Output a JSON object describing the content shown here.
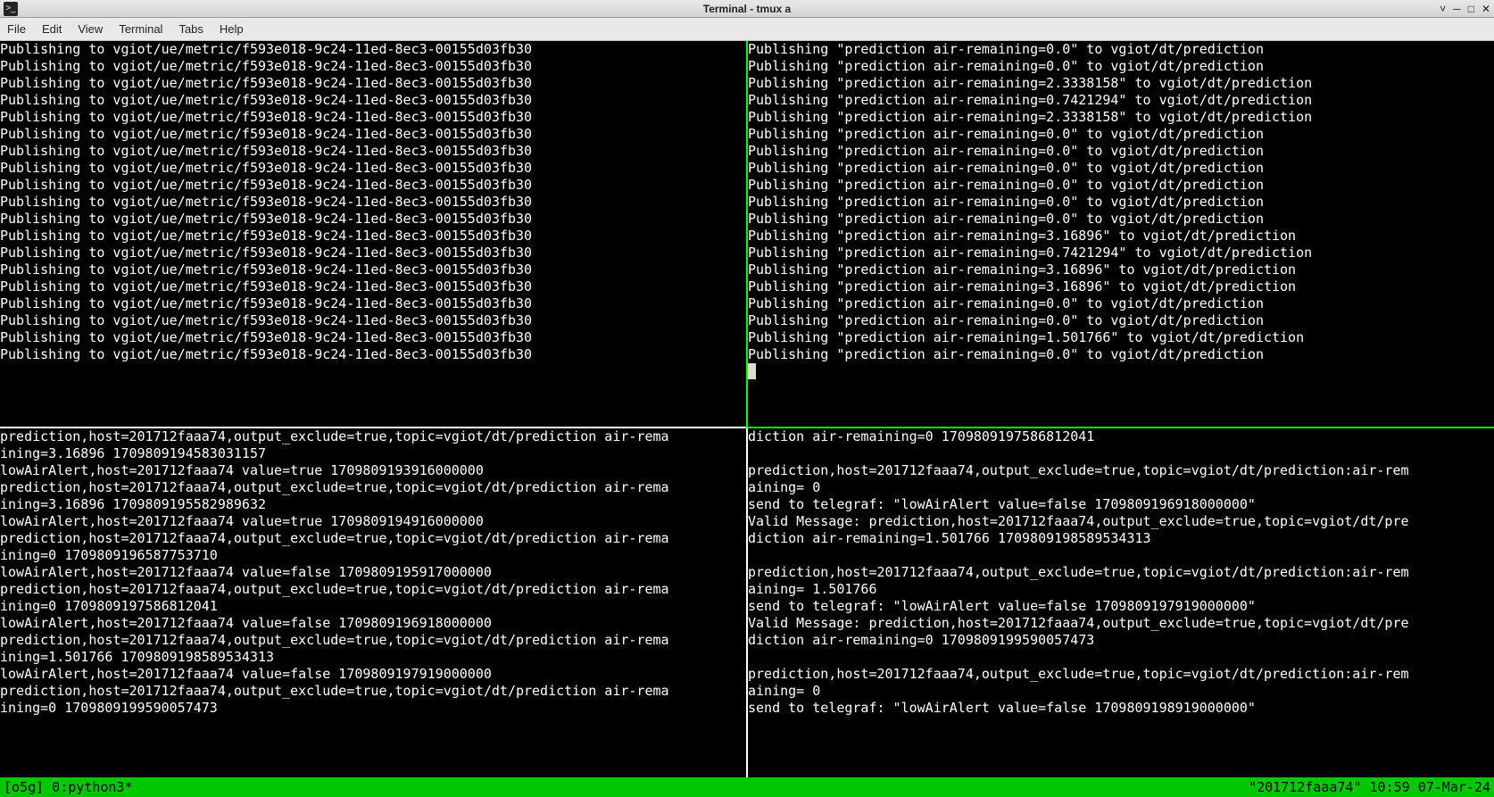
{
  "window": {
    "title": "Terminal - tmux a"
  },
  "menu": {
    "file": "File",
    "edit": "Edit",
    "view": "View",
    "terminal": "Terminal",
    "tabs": "Tabs",
    "help": "Help"
  },
  "panes": {
    "top_left": {
      "lines": [
        "Publishing to vgiot/ue/metric/f593e018-9c24-11ed-8ec3-00155d03fb30",
        "Publishing to vgiot/ue/metric/f593e018-9c24-11ed-8ec3-00155d03fb30",
        "Publishing to vgiot/ue/metric/f593e018-9c24-11ed-8ec3-00155d03fb30",
        "Publishing to vgiot/ue/metric/f593e018-9c24-11ed-8ec3-00155d03fb30",
        "Publishing to vgiot/ue/metric/f593e018-9c24-11ed-8ec3-00155d03fb30",
        "Publishing to vgiot/ue/metric/f593e018-9c24-11ed-8ec3-00155d03fb30",
        "Publishing to vgiot/ue/metric/f593e018-9c24-11ed-8ec3-00155d03fb30",
        "Publishing to vgiot/ue/metric/f593e018-9c24-11ed-8ec3-00155d03fb30",
        "Publishing to vgiot/ue/metric/f593e018-9c24-11ed-8ec3-00155d03fb30",
        "Publishing to vgiot/ue/metric/f593e018-9c24-11ed-8ec3-00155d03fb30",
        "Publishing to vgiot/ue/metric/f593e018-9c24-11ed-8ec3-00155d03fb30",
        "Publishing to vgiot/ue/metric/f593e018-9c24-11ed-8ec3-00155d03fb30",
        "Publishing to vgiot/ue/metric/f593e018-9c24-11ed-8ec3-00155d03fb30",
        "Publishing to vgiot/ue/metric/f593e018-9c24-11ed-8ec3-00155d03fb30",
        "Publishing to vgiot/ue/metric/f593e018-9c24-11ed-8ec3-00155d03fb30",
        "Publishing to vgiot/ue/metric/f593e018-9c24-11ed-8ec3-00155d03fb30",
        "Publishing to vgiot/ue/metric/f593e018-9c24-11ed-8ec3-00155d03fb30",
        "Publishing to vgiot/ue/metric/f593e018-9c24-11ed-8ec3-00155d03fb30",
        "Publishing to vgiot/ue/metric/f593e018-9c24-11ed-8ec3-00155d03fb30"
      ]
    },
    "top_right": {
      "lines": [
        "Publishing \"prediction air-remaining=0.0\" to vgiot/dt/prediction",
        "Publishing \"prediction air-remaining=0.0\" to vgiot/dt/prediction",
        "Publishing \"prediction air-remaining=2.3338158\" to vgiot/dt/prediction",
        "Publishing \"prediction air-remaining=0.7421294\" to vgiot/dt/prediction",
        "Publishing \"prediction air-remaining=2.3338158\" to vgiot/dt/prediction",
        "Publishing \"prediction air-remaining=0.0\" to vgiot/dt/prediction",
        "Publishing \"prediction air-remaining=0.0\" to vgiot/dt/prediction",
        "Publishing \"prediction air-remaining=0.0\" to vgiot/dt/prediction",
        "Publishing \"prediction air-remaining=0.0\" to vgiot/dt/prediction",
        "Publishing \"prediction air-remaining=0.0\" to vgiot/dt/prediction",
        "Publishing \"prediction air-remaining=0.0\" to vgiot/dt/prediction",
        "Publishing \"prediction air-remaining=3.16896\" to vgiot/dt/prediction",
        "Publishing \"prediction air-remaining=0.7421294\" to vgiot/dt/prediction",
        "Publishing \"prediction air-remaining=3.16896\" to vgiot/dt/prediction",
        "Publishing \"prediction air-remaining=3.16896\" to vgiot/dt/prediction",
        "Publishing \"prediction air-remaining=0.0\" to vgiot/dt/prediction",
        "Publishing \"prediction air-remaining=0.0\" to vgiot/dt/prediction",
        "Publishing \"prediction air-remaining=1.501766\" to vgiot/dt/prediction",
        "Publishing \"prediction air-remaining=0.0\" to vgiot/dt/prediction"
      ]
    },
    "bottom_left": {
      "lines": [
        "prediction,host=201712faaa74,output_exclude=true,topic=vgiot/dt/prediction air-rema",
        "ining=3.16896 1709809194583031157",
        "lowAirAlert,host=201712faaa74 value=true 1709809193916000000",
        "prediction,host=201712faaa74,output_exclude=true,topic=vgiot/dt/prediction air-rema",
        "ining=3.16896 1709809195582989632",
        "lowAirAlert,host=201712faaa74 value=true 1709809194916000000",
        "prediction,host=201712faaa74,output_exclude=true,topic=vgiot/dt/prediction air-rema",
        "ining=0 1709809196587753710",
        "lowAirAlert,host=201712faaa74 value=false 1709809195917000000",
        "prediction,host=201712faaa74,output_exclude=true,topic=vgiot/dt/prediction air-rema",
        "ining=0 1709809197586812041",
        "lowAirAlert,host=201712faaa74 value=false 1709809196918000000",
        "prediction,host=201712faaa74,output_exclude=true,topic=vgiot/dt/prediction air-rema",
        "ining=1.501766 1709809198589534313",
        "lowAirAlert,host=201712faaa74 value=false 1709809197919000000",
        "prediction,host=201712faaa74,output_exclude=true,topic=vgiot/dt/prediction air-rema",
        "ining=0 1709809199590057473"
      ]
    },
    "bottom_right": {
      "lines": [
        "diction air-remaining=0 1709809197586812041",
        "",
        "prediction,host=201712faaa74,output_exclude=true,topic=vgiot/dt/prediction:air-rem",
        "aining= 0",
        "send to telegraf: \"lowAirAlert value=false 1709809196918000000\"",
        "Valid Message: prediction,host=201712faaa74,output_exclude=true,topic=vgiot/dt/pre",
        "diction air-remaining=1.501766 1709809198589534313",
        "",
        "prediction,host=201712faaa74,output_exclude=true,topic=vgiot/dt/prediction:air-rem",
        "aining= 1.501766",
        "send to telegraf: \"lowAirAlert value=false 1709809197919000000\"",
        "Valid Message: prediction,host=201712faaa74,output_exclude=true,topic=vgiot/dt/pre",
        "diction air-remaining=0 1709809199590057473",
        "",
        "prediction,host=201712faaa74,output_exclude=true,topic=vgiot/dt/prediction:air-rem",
        "aining= 0",
        "send to telegraf: \"lowAirAlert value=false 1709809198919000000\""
      ]
    }
  },
  "status": {
    "left": "[o5g] 0:python3*",
    "right": "\"201712faaa74\" 10:59 07-Mar-24"
  }
}
